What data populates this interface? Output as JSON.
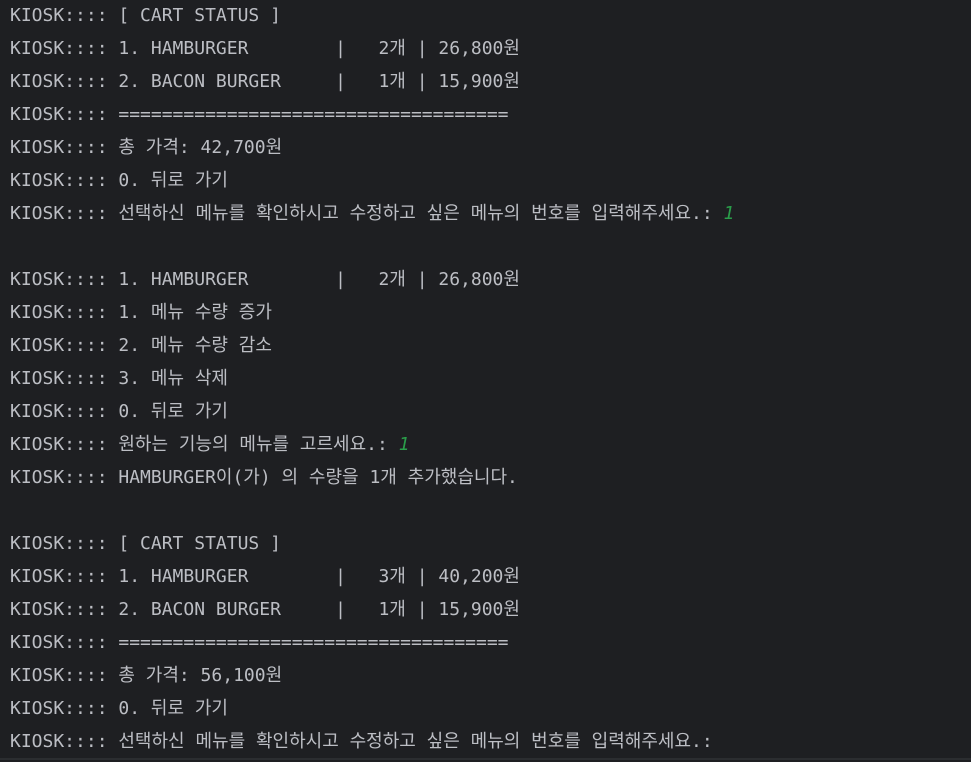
{
  "console": {
    "lines": [
      {
        "text": "KIOSK:::: [ CART STATUS ]",
        "input": ""
      },
      {
        "text": "KIOSK:::: 1. HAMBURGER        |   2개 | 26,800원",
        "input": ""
      },
      {
        "text": "KIOSK:::: 2. BACON BURGER     |   1개 | 15,900원",
        "input": ""
      },
      {
        "text": "KIOSK:::: ====================================",
        "input": ""
      },
      {
        "text": "KIOSK:::: 총 가격: 42,700원",
        "input": ""
      },
      {
        "text": "KIOSK:::: 0. 뒤로 가기",
        "input": ""
      },
      {
        "text": "KIOSK:::: 선택하신 메뉴를 확인하시고 수정하고 싶은 메뉴의 번호를 입력해주세요.: ",
        "input": "1"
      },
      {
        "text": "",
        "input": ""
      },
      {
        "text": "KIOSK:::: 1. HAMBURGER        |   2개 | 26,800원",
        "input": ""
      },
      {
        "text": "KIOSK:::: 1. 메뉴 수량 증가",
        "input": ""
      },
      {
        "text": "KIOSK:::: 2. 메뉴 수량 감소",
        "input": ""
      },
      {
        "text": "KIOSK:::: 3. 메뉴 삭제",
        "input": ""
      },
      {
        "text": "KIOSK:::: 0. 뒤로 가기",
        "input": ""
      },
      {
        "text": "KIOSK:::: 원하는 기능의 메뉴를 고르세요.: ",
        "input": "1"
      },
      {
        "text": "KIOSK:::: HAMBURGER이(가) 의 수량을 1개 추가했습니다.",
        "input": ""
      },
      {
        "text": "",
        "input": ""
      },
      {
        "text": "KIOSK:::: [ CART STATUS ]",
        "input": ""
      },
      {
        "text": "KIOSK:::: 1. HAMBURGER        |   3개 | 40,200원",
        "input": ""
      },
      {
        "text": "KIOSK:::: 2. BACON BURGER     |   1개 | 15,900원",
        "input": ""
      },
      {
        "text": "KIOSK:::: ====================================",
        "input": ""
      },
      {
        "text": "KIOSK:::: 총 가격: 56,100원",
        "input": ""
      },
      {
        "text": "KIOSK:::: 0. 뒤로 가기",
        "input": ""
      },
      {
        "text": "KIOSK:::: 선택하신 메뉴를 확인하시고 수정하고 싶은 메뉴의 번호를 입력해주세요.: ",
        "input": ""
      }
    ],
    "colors": {
      "background": "#1e1f22",
      "text": "#bcbec4",
      "user_input": "#2a9d4a"
    }
  }
}
